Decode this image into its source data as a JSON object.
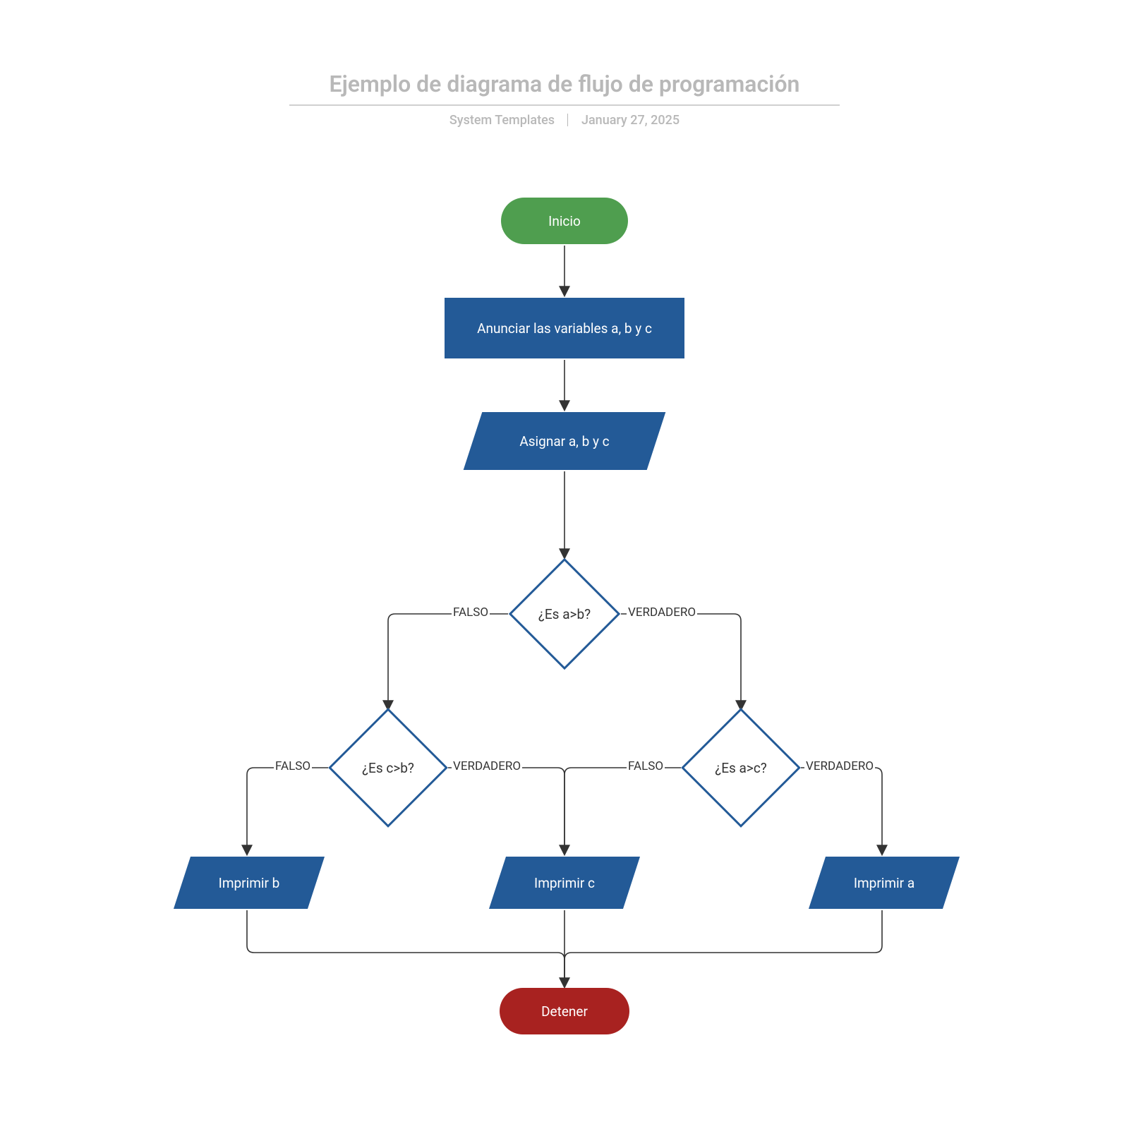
{
  "header": {
    "title": "Ejemplo de diagrama de flujo de programación",
    "author": "System Templates",
    "date": "January 27, 2025"
  },
  "labels": {
    "false": "FALSO",
    "true": "VERDADERO"
  },
  "nodes": {
    "start": "Inicio",
    "declare": "Anunciar las variables a, b y c",
    "assign": "Asignar a, b y c",
    "cond_ab": "¿Es a>b?",
    "cond_cb": "¿Es c>b?",
    "cond_ac": "¿Es a>c?",
    "print_b": "Imprimir b",
    "print_c": "Imprimir c",
    "print_a": "Imprimir a",
    "stop": "Detener"
  },
  "colors": {
    "start": "#4f9e4f",
    "stop": "#a82220",
    "process": "#235a97",
    "outline": "#235a97",
    "title": "#b8b8b8",
    "arrow": "#333333"
  }
}
